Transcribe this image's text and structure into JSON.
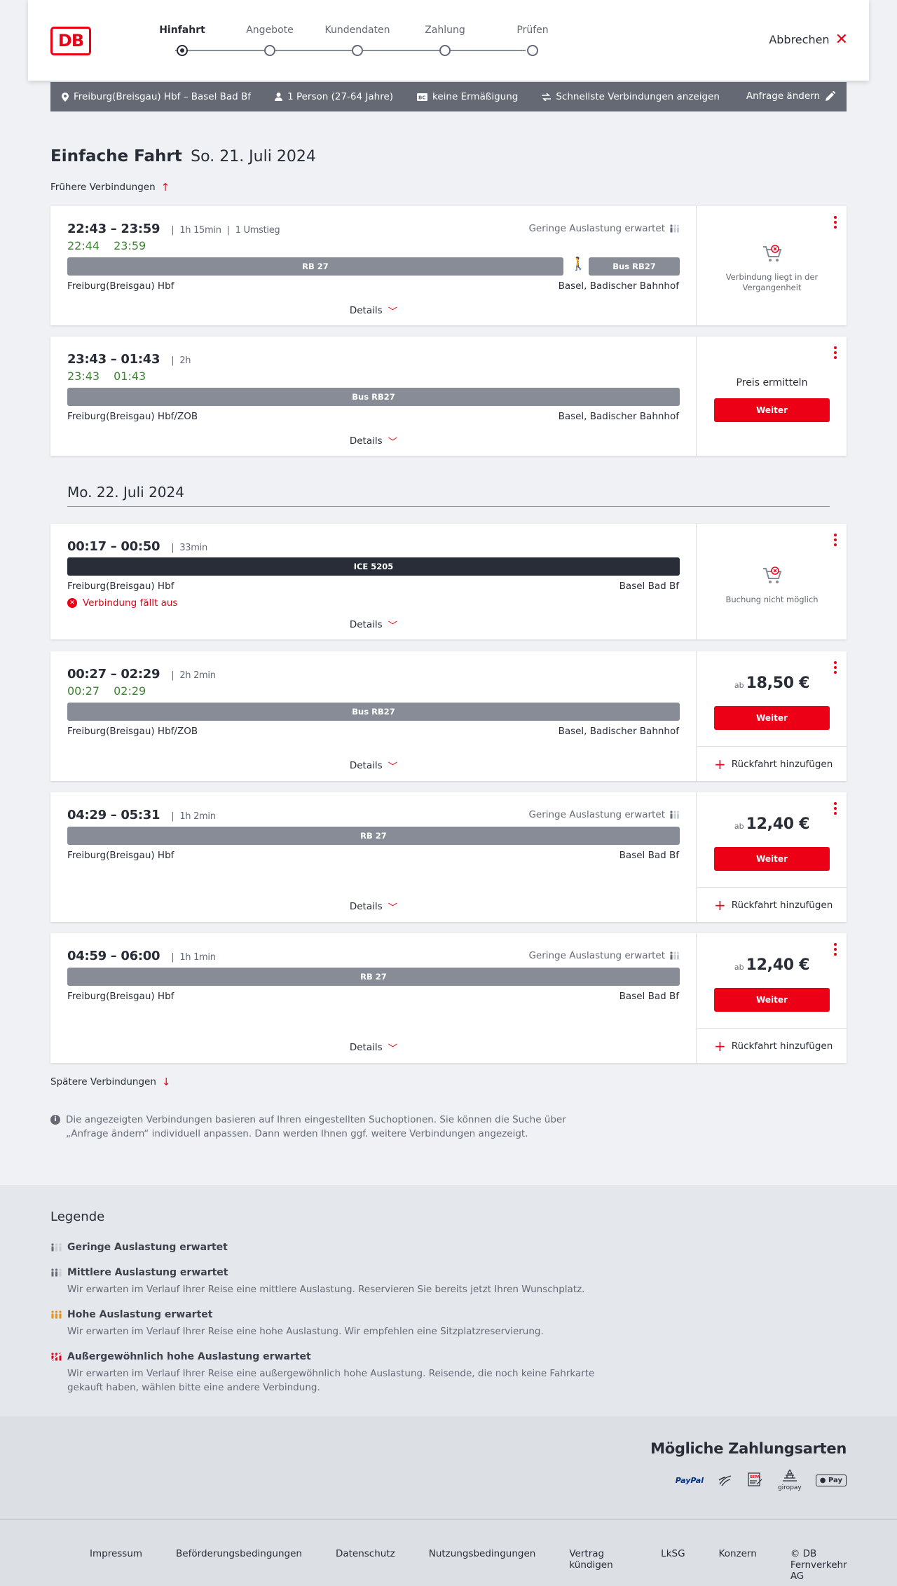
{
  "header": {
    "logo": "DB",
    "steps": [
      {
        "label": "Hinfahrt",
        "active": true
      },
      {
        "label": "Angebote",
        "active": false
      },
      {
        "label": "Kundendaten",
        "active": false
      },
      {
        "label": "Zahlung",
        "active": false
      },
      {
        "label": "Prüfen",
        "active": false
      }
    ],
    "cancel_label": "Abbrechen"
  },
  "summary": {
    "route": "Freiburg(Breisgau) Hbf – Basel Bad Bf",
    "passengers": "1 Person (27-64 Jahre)",
    "discount": "keine Ermäßigung",
    "fastest": "Schnellste Verbindungen anzeigen",
    "edit_label": "Anfrage ändern"
  },
  "page": {
    "title": "Einfache Fahrt",
    "date": "So. 21. Juli 2024",
    "earlier_label": "Frühere Verbindungen",
    "later_label": "Spätere Verbindungen",
    "next_day": "Mo. 22. Juli 2024",
    "info_note": "Die angezeigten Verbindungen basieren auf Ihren eingestellten Suchoptionen. Sie können die Suche über „Anfrage ändern“ individuell anpassen. Dann werden Ihnen ggf. weitere Verbindungen angezeigt."
  },
  "connections": [
    {
      "times": "22:43 – 23:59",
      "duration": "1h 15min",
      "changes": "1 Umstieg",
      "rt_dep": "22:44",
      "rt_arr": "23:59",
      "load": "Geringe Auslastung erwartet",
      "legs": [
        "RB 27",
        "Bus RB27"
      ],
      "from": "Freiburg(Breisgau) Hbf",
      "to": "Basel, Badischer Bahnhof",
      "details": "Details",
      "side_note": "Verbindung liegt in der Vergangenheit"
    },
    {
      "times": "23:43 – 01:43",
      "duration": "2h",
      "rt_dep": "23:43",
      "rt_arr": "01:43",
      "legs": [
        "Bus RB27"
      ],
      "from": "Freiburg(Breisgau) Hbf/ZOB",
      "to": "Basel, Badischer Bahnhof",
      "details": "Details",
      "price_label": "Preis ermitteln",
      "button": "Weiter"
    },
    {
      "times": "00:17 – 00:50",
      "duration": "33min",
      "legs": [
        "ICE 5205"
      ],
      "from": "Freiburg(Breisgau) Hbf",
      "to": "Basel Bad Bf",
      "cancelled": "Verbindung fällt aus",
      "details": "Details",
      "side_note": "Buchung nicht möglich"
    },
    {
      "times": "00:27 – 02:29",
      "duration": "2h 2min",
      "rt_dep": "00:27",
      "rt_arr": "02:29",
      "legs": [
        "Bus RB27"
      ],
      "from": "Freiburg(Breisgau) Hbf/ZOB",
      "to": "Basel, Badischer Bahnhof",
      "details": "Details",
      "price_prefix": "ab",
      "price": "18,50 €",
      "button": "Weiter",
      "return_label": "Rückfahrt hinzufügen"
    },
    {
      "times": "04:29 – 05:31",
      "duration": "1h 2min",
      "load": "Geringe Auslastung erwartet",
      "legs": [
        "RB 27"
      ],
      "from": "Freiburg(Breisgau) Hbf",
      "to": "Basel Bad Bf",
      "details": "Details",
      "price_prefix": "ab",
      "price": "12,40 €",
      "button": "Weiter",
      "return_label": "Rückfahrt hinzufügen"
    },
    {
      "times": "04:59 – 06:00",
      "duration": "1h 1min",
      "load": "Geringe Auslastung erwartet",
      "legs": [
        "RB 27"
      ],
      "from": "Freiburg(Breisgau) Hbf",
      "to": "Basel Bad Bf",
      "details": "Details",
      "price_prefix": "ab",
      "price": "12,40 €",
      "button": "Weiter",
      "return_label": "Rückfahrt hinzufügen"
    }
  ],
  "legend": {
    "title": "Legende",
    "items": [
      {
        "head": "Geringe Auslastung erwartet",
        "text": ""
      },
      {
        "head": "Mittlere Auslastung erwartet",
        "text": "Wir erwarten im Verlauf Ihrer Reise eine mittlere Auslastung. Reservieren Sie bereits jetzt Ihren Wunschplatz."
      },
      {
        "head": "Hohe Auslastung erwartet",
        "text": "Wir erwarten im Verlauf Ihrer Reise eine hohe Auslastung. Wir empfehlen eine Sitzplatzreservierung."
      },
      {
        "head": "Außergewöhnlich hohe Auslastung erwartet",
        "text": "Wir erwarten im Verlauf Ihrer Reise eine außergewöhnlich hohe Auslastung. Reisende, die noch keine Fahrkarte gekauft haben, wählen bitte eine andere Verbindung."
      }
    ],
    "colors": {
      "low": "#646973",
      "mid": "#646973",
      "high": "#f39200",
      "very_high": "#ec0016"
    }
  },
  "payments": {
    "title": "Mögliche Zahlungsarten",
    "methods": [
      "PayPal",
      "Lastschrift",
      "SEPA",
      "giropay",
      "Pay"
    ]
  },
  "footer": {
    "links": [
      "Impressum",
      "Beförderungsbedingungen",
      "Datenschutz",
      "Nutzungsbedingungen",
      "Vertrag kündigen",
      "LkSG",
      "Konzern",
      "© DB Fernverkehr AG"
    ]
  },
  "colors": {
    "brand": "#ec0016",
    "realtime": "#408335",
    "bar": "#878c96",
    "ice_bar": "#282d37"
  }
}
